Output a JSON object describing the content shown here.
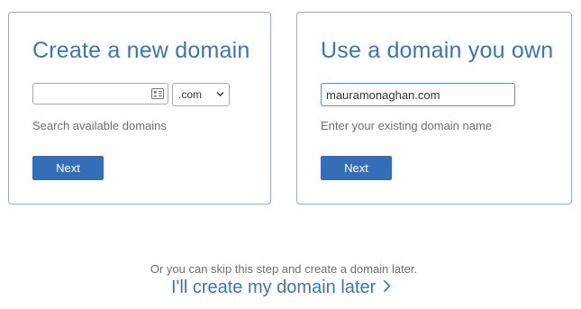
{
  "create_card": {
    "title": "Create a new domain",
    "input_value": "",
    "input_placeholder": "",
    "input_icon": "contact-card-icon",
    "tld_selected": ".com",
    "helper": "Search available domains",
    "button_label": "Next"
  },
  "own_card": {
    "title": "Use a domain you own",
    "input_value": "mauramonaghan.com",
    "helper": "Enter your existing domain name",
    "button_label": "Next"
  },
  "skip": {
    "text": "Or you can skip this step and create a domain later.",
    "link_label": "I'll create my domain later",
    "link_icon": "chevron-right-icon"
  },
  "colors": {
    "accent": "#3c74bb",
    "button": "#346eb8",
    "border": "#8fb0d8"
  }
}
